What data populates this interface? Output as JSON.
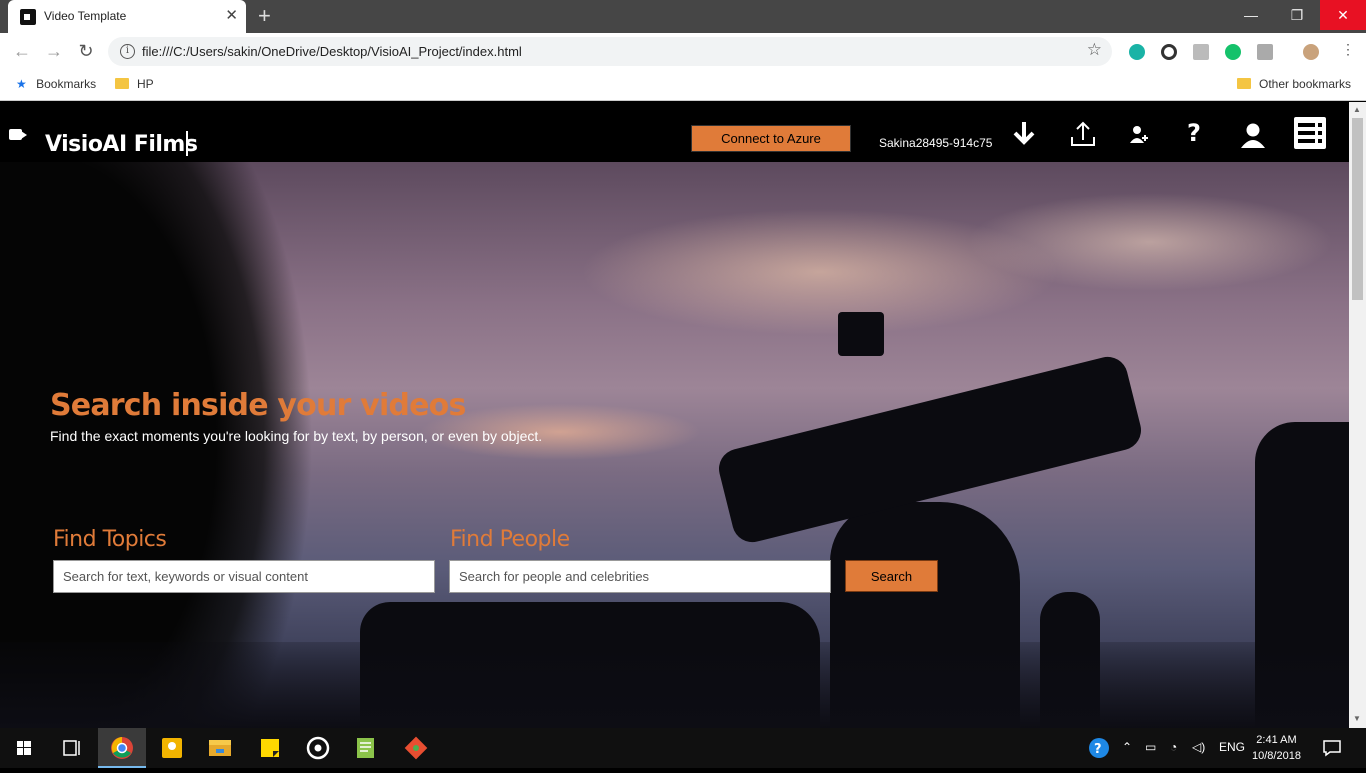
{
  "browser": {
    "tab_title": "Video Template",
    "url": "file:///C:/Users/sakin/OneDrive/Desktop/VisioAI_Project/index.html",
    "bookmarks": [
      "Bookmarks",
      "HP"
    ],
    "other_bookmarks": "Other bookmarks",
    "window_controls": {
      "minimize": "—",
      "restore": "❐",
      "close": "✕"
    }
  },
  "navbar": {
    "brand": "VisioAI Films",
    "connect_label": "Connect to Azure",
    "account_name": "Sakina28495-914c75",
    "icons": [
      "download-icon",
      "upload-icon",
      "add-user-icon",
      "help-icon",
      "profile-icon",
      "menu-icon"
    ]
  },
  "hero": {
    "headline": "Search inside your videos",
    "subline": "Find the exact moments you're looking for by text, by person, or even by object.",
    "topics_label": "Find Topics",
    "topics_placeholder": "Search for text, keywords or visual content",
    "people_label": "Find People",
    "people_placeholder": "Search for people and celebrities",
    "search_label": "Search"
  },
  "taskbar": {
    "language": "ENG",
    "time": "2:41 AM",
    "date": "10/8/2018"
  },
  "colors": {
    "accent": "#e07b39",
    "navbar": "#000000"
  }
}
